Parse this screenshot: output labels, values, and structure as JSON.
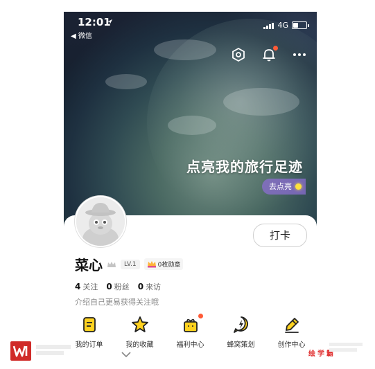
{
  "status_bar": {
    "time": "12:01",
    "back_app": "◀ 微信",
    "network": "4G"
  },
  "hero": {
    "title": "点亮我的旅行足迹",
    "cta_label": "去点亮"
  },
  "top_icons": [
    "settings-hexagon-icon",
    "bell-icon",
    "more-dots-icon"
  ],
  "profile": {
    "username": "菜心",
    "level": "LV.1",
    "medal": "0枚勋章",
    "checkin_label": "打卡",
    "stats": [
      {
        "count": "4",
        "label": "关注"
      },
      {
        "count": "0",
        "label": "粉丝"
      },
      {
        "count": "0",
        "label": "来访"
      }
    ],
    "bio_placeholder": "介绍自己更易获得关注哦"
  },
  "quick_menu": [
    {
      "label": "我的订单",
      "icon": "order-icon"
    },
    {
      "label": "我的收藏",
      "icon": "star-icon"
    },
    {
      "label": "福利中心",
      "icon": "gift-icon"
    },
    {
      "label": "蜂窝策划",
      "icon": "lightning-bubble-icon"
    },
    {
      "label": "创作中心",
      "icon": "pen-icon"
    }
  ],
  "watermark": {
    "right_text": "绘学霸"
  },
  "colors": {
    "accent_yellow": "#ffd21f",
    "notification_red": "#ff5a36",
    "cta_purple": "#8c6ed2"
  }
}
